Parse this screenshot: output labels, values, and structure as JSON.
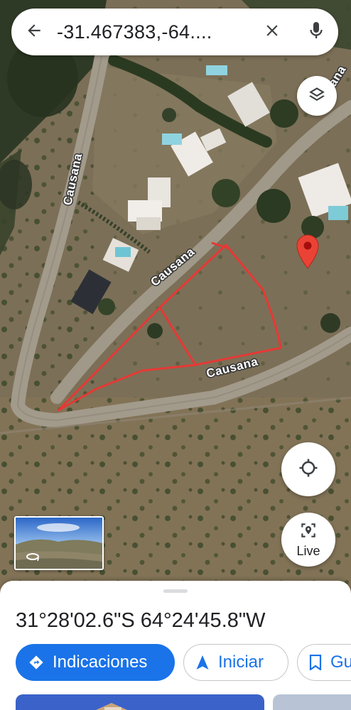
{
  "search": {
    "query": "-31.467383,-64....",
    "back_icon": "arrow-back-icon",
    "clear_icon": "close-icon",
    "mic_icon": "mic-icon"
  },
  "map": {
    "type": "satellite",
    "street_labels": [
      "Causana",
      "Causana",
      "Causana",
      "Causana"
    ],
    "pin_color": "#ea4335",
    "drawn_outline_color": "#e53935"
  },
  "controls": {
    "layers_icon": "layers-icon",
    "locate_icon": "my-location-icon",
    "live_label": "Live",
    "live_icon": "live-view-icon",
    "street_view_icon": "street-view-360-icon"
  },
  "sheet": {
    "coordinates": "31°28'02.6\"S 64°24'45.8\"W",
    "actions": {
      "directions": "Indicaciones",
      "start": "Iniciar",
      "save": "Gu"
    }
  },
  "colors": {
    "accent": "#1a73e8",
    "text": "#202124"
  }
}
